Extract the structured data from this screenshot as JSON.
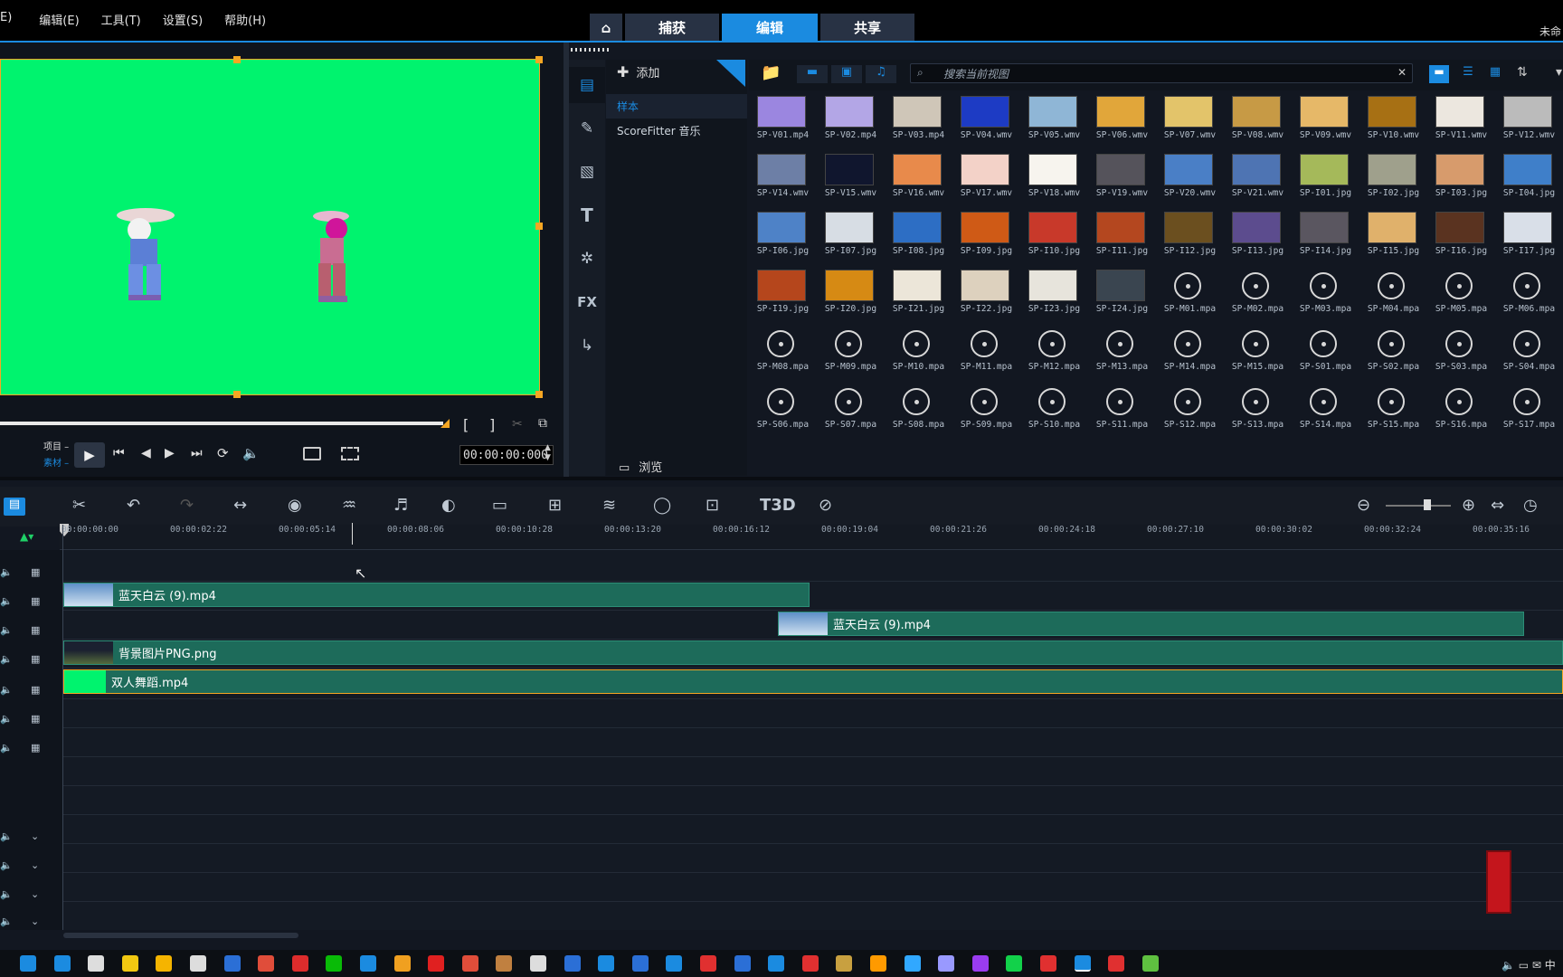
{
  "menu": {
    "item0": "E)",
    "edit": "编辑(E)",
    "tools": "工具(T)",
    "settings": "设置(S)",
    "help": "帮助(H)"
  },
  "tabs": {
    "capture": "捕获",
    "edit": "编辑",
    "share": "共享"
  },
  "project_title": "未命",
  "preview": {
    "mode_project": "项目 –",
    "mode_clip": "素材 –",
    "timecode": "00:00:00:000"
  },
  "library": {
    "add_label": "添加",
    "tree": [
      "样本",
      "ScoreFitter 音乐"
    ],
    "browse_label": "浏览",
    "search_placeholder": "搜索当前视图",
    "items": [
      "SP-V01.mp4",
      "SP-V02.mp4",
      "SP-V03.mp4",
      "SP-V04.wmv",
      "SP-V05.wmv",
      "SP-V06.wmv",
      "SP-V07.wmv",
      "SP-V08.wmv",
      "SP-V09.wmv",
      "SP-V10.wmv",
      "SP-V11.wmv",
      "SP-V12.wmv",
      "SP-V14.wmv",
      "SP-V15.wmv",
      "SP-V16.wmv",
      "SP-V17.wmv",
      "SP-V18.wmv",
      "SP-V19.wmv",
      "SP-V20.wmv",
      "SP-V21.wmv",
      "SP-I01.jpg",
      "SP-I02.jpg",
      "SP-I03.jpg",
      "SP-I04.jpg",
      "SP-I06.jpg",
      "SP-I07.jpg",
      "SP-I08.jpg",
      "SP-I09.jpg",
      "SP-I10.jpg",
      "SP-I11.jpg",
      "SP-I12.jpg",
      "SP-I13.jpg",
      "SP-I14.jpg",
      "SP-I15.jpg",
      "SP-I16.jpg",
      "SP-I17.jpg",
      "SP-I19.jpg",
      "SP-I20.jpg",
      "SP-I21.jpg",
      "SP-I22.jpg",
      "SP-I23.jpg",
      "SP-I24.jpg",
      "SP-M01.mpa",
      "SP-M02.mpa",
      "SP-M03.mpa",
      "SP-M04.mpa",
      "SP-M05.mpa",
      "SP-M06.mpa",
      "SP-M08.mpa",
      "SP-M09.mpa",
      "SP-M10.mpa",
      "SP-M11.mpa",
      "SP-M12.mpa",
      "SP-M13.mpa",
      "SP-M14.mpa",
      "SP-M15.mpa",
      "SP-S01.mpa",
      "SP-S02.mpa",
      "SP-S03.mpa",
      "SP-S04.mpa",
      "SP-S06.mpa",
      "SP-S07.mpa",
      "SP-S08.mpa",
      "SP-S09.mpa",
      "SP-S10.mpa",
      "SP-S11.mpa",
      "SP-S12.mpa",
      "SP-S13.mpa",
      "SP-S14.mpa",
      "SP-S15.mpa",
      "SP-S16.mpa",
      "SP-S17.mpa"
    ],
    "thumb_colors": [
      "#9b86e0",
      "#b3a6e6",
      "#cfc6b8",
      "#1d3bc4",
      "#8fb6d6",
      "#e1a63a",
      "#e3c46a",
      "#c79a45",
      "#e6b868",
      "#a77014",
      "#ece7df",
      "#bbbbbb",
      "#6d7fa6",
      "#10162e",
      "#e88a4b",
      "#f3d2c8",
      "#f7f4ee",
      "#55535b",
      "#4a7fc6",
      "#4e74b3",
      "#a5b95a",
      "#9fa08c",
      "#d79b6c",
      "#3f7fc9",
      "#4e82c7",
      "#d7dde4",
      "#2d6ec4",
      "#cf5a16",
      "#c8392a",
      "#b4471f",
      "#6b4f1f",
      "#5c4c8e",
      "#5a5660",
      "#e0b16b",
      "#5a3320",
      "#d9dfe8",
      "#b5461c",
      "#d68a14",
      "#ece6d9",
      "#ddd1be",
      "#e7e4dc",
      "#3a4550"
    ]
  },
  "timeline": {
    "ticks": [
      "00:00:00:00",
      "00:00:02:22",
      "00:00:05:14",
      "00:00:08:06",
      "00:00:10:28",
      "00:00:13:20",
      "00:00:16:12",
      "00:00:19:04",
      "00:00:21:26",
      "00:00:24:18",
      "00:00:27:10",
      "00:00:30:02",
      "00:00:32:24",
      "00:00:35:16"
    ],
    "clips": {
      "c1": "蓝天白云 (9).mp4",
      "c2": "蓝天白云 (9).mp4",
      "c3": "背景图片PNG.png",
      "c4": "双人舞蹈.mp4"
    }
  },
  "colors": {
    "accent": "#1b8be0",
    "clip": "#1d6b5a",
    "preview_bg": "#00f36e",
    "handle": "#f5a623"
  }
}
